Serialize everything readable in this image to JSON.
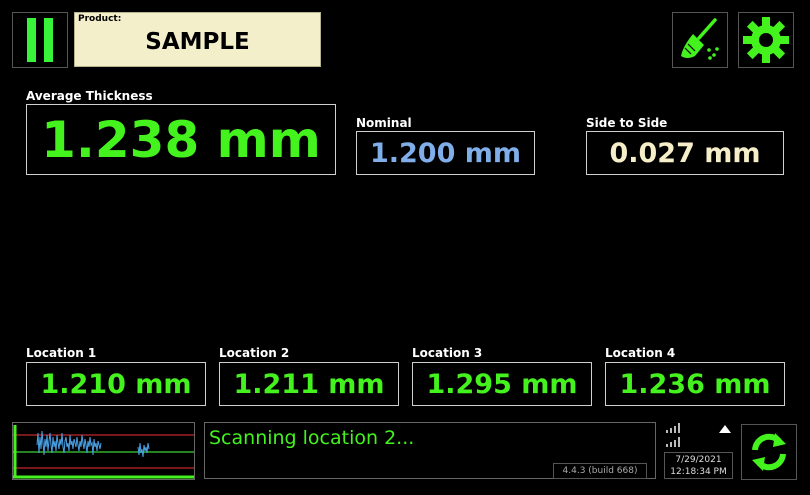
{
  "header": {
    "product_label": "Product:",
    "product_value": "SAMPLE"
  },
  "measurements": {
    "average": {
      "label": "Average Thickness",
      "value": "1.238 mm"
    },
    "nominal": {
      "label": "Nominal",
      "value": "1.200 mm"
    },
    "side_to_side": {
      "label": "Side to Side",
      "value": "0.027 mm"
    }
  },
  "locations": [
    {
      "label": "Location 1",
      "value": "1.210 mm"
    },
    {
      "label": "Location 2",
      "value": "1.211 mm"
    },
    {
      "label": "Location 3",
      "value": "1.295 mm"
    },
    {
      "label": "Location 4",
      "value": "1.236 mm"
    }
  ],
  "status": {
    "message": "Scanning location 2...",
    "version": "4.4.3 (build 668)",
    "date": "7/29/2021",
    "time": "12:18:34 PM"
  },
  "icons": {
    "pause": "pause-icon",
    "clean": "broom-icon",
    "settings": "gear-icon",
    "signal": "signal-icon",
    "expand": "triangle-up-icon",
    "refresh": "refresh-icon"
  },
  "colors": {
    "accent_green": "#44f21e",
    "nominal_blue": "#7faee8",
    "side_cream": "#f6eec8",
    "product_bg": "#f3efcb"
  }
}
